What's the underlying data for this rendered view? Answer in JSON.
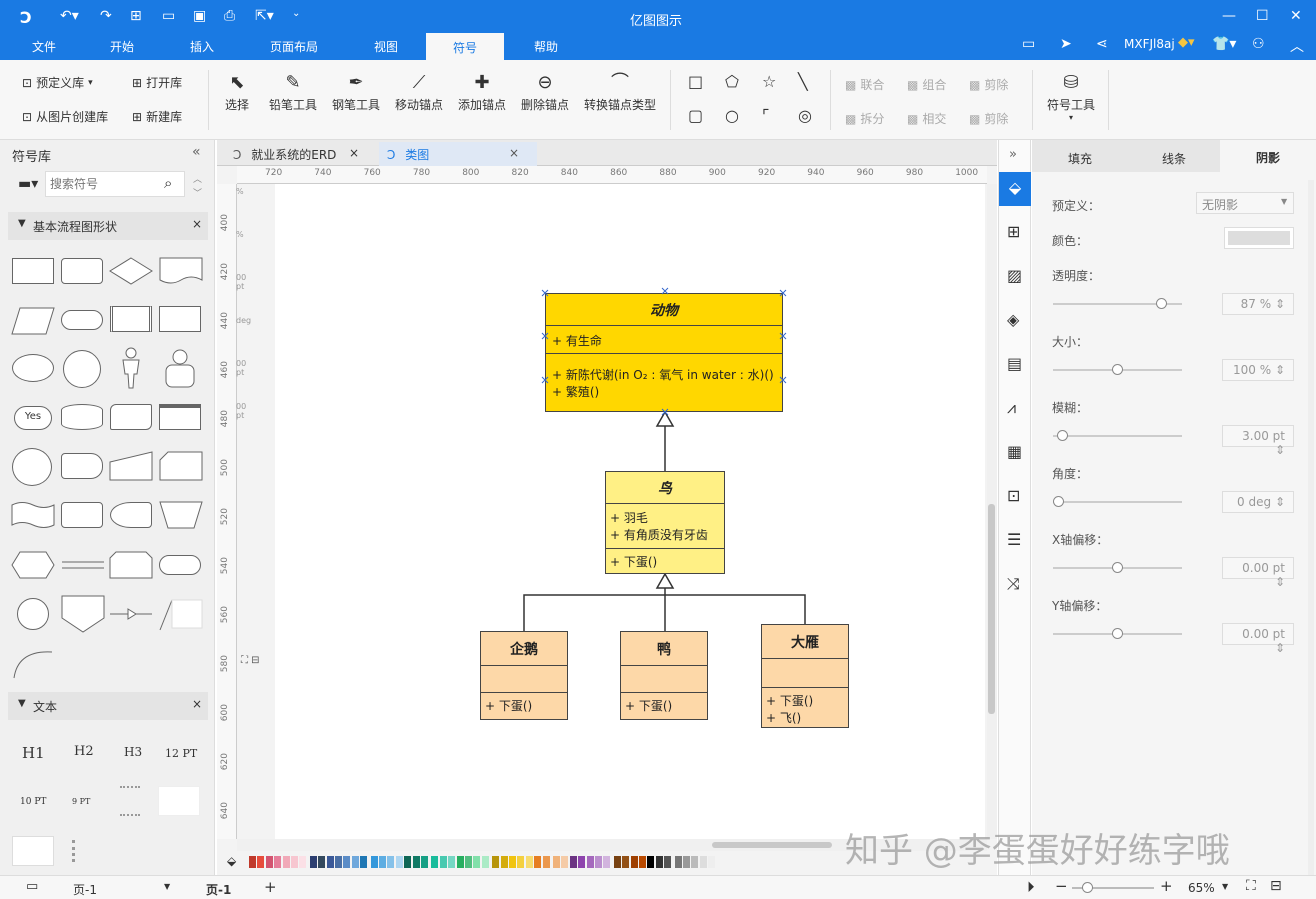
{
  "app": {
    "title": "亿图图示"
  },
  "menu": [
    "文件",
    "开始",
    "插入",
    "页面布局",
    "视图",
    "符号",
    "帮助"
  ],
  "user": {
    "name": "MXFJl8aj"
  },
  "ribbon": {
    "lib_predefined": "预定义库",
    "lib_open": "打开库",
    "lib_from_image": "从图片创建库",
    "lib_new": "新建库",
    "tools": [
      "选择",
      "铅笔工具",
      "钢笔工具",
      "移动锚点",
      "添加锚点",
      "删除锚点",
      "转换锚点类型"
    ],
    "ops_row1": [
      "联合",
      "组合",
      "剪除"
    ],
    "ops_row2": [
      "拆分",
      "相交",
      "剪除"
    ],
    "symbol_tool": "符号工具"
  },
  "left": {
    "title": "符号库",
    "search_placeholder": "搜索符号",
    "section1": "基本流程图形状",
    "section2": "文本",
    "text_items": [
      "H1",
      "H2",
      "H3",
      "12 PT",
      "10 PT",
      "9 PT"
    ],
    "yes_label": "Yes"
  },
  "tabs": [
    {
      "label": "就业系统的ERD"
    },
    {
      "label": "类图"
    }
  ],
  "ruler_top": [
    "720",
    "740",
    "760",
    "780",
    "800",
    "820",
    "840",
    "860",
    "880",
    "900",
    "920",
    "940",
    "960",
    "980",
    "1000"
  ],
  "ruler_left": [
    "400",
    "420",
    "440",
    "460",
    "480",
    "500",
    "520",
    "540",
    "560",
    "580",
    "600",
    "620",
    "640"
  ],
  "ruler_fields": [
    "%",
    "%",
    "00 pt",
    "deg",
    "00 pt",
    "00 pt"
  ],
  "diagram": {
    "animal": {
      "name": "动物",
      "attr": "+   有生命",
      "m1": "+   新陈代谢(in O₂ : 氧气  in water : 水)()",
      "m2": "+   繁殖()"
    },
    "bird": {
      "name": "鸟",
      "a1": "+   羽毛",
      "a2": "+   有角质没有牙齿",
      "m1": "+   下蛋()"
    },
    "penguin": {
      "name": "企鹅",
      "m1": "+   下蛋()"
    },
    "duck": {
      "name": "鸭",
      "m1": "+   下蛋()"
    },
    "goose": {
      "name": "大雁",
      "m1": "+   下蛋()",
      "m2": "+   飞()"
    }
  },
  "right": {
    "tabs": [
      "填充",
      "线条",
      "阴影"
    ],
    "predefined_label": "预定义：",
    "predefined_value": "无阴影",
    "color_label": "颜色：",
    "transparency_label": "透明度：",
    "transparency_value": "87 %",
    "size_label": "大小：",
    "size_value": "100 %",
    "blur_label": "模糊：",
    "blur_value": "3.00 pt",
    "angle_label": "角度：",
    "angle_value": "0 deg",
    "xoffset_label": "X轴偏移：",
    "xoffset_value": "0.00 pt",
    "yoffset_label": "Y轴偏移：",
    "yoffset_value": "0.00 pt"
  },
  "status": {
    "page_select": "页-1",
    "page_tab": "页-1",
    "zoom": "65%"
  },
  "watermark": "知乎 @李蛋蛋好好练字哦",
  "colors": {
    "accent": "#1a7ae3",
    "animal_fill": "#ffd700",
    "bird_fill": "#fff085",
    "sub_fill": "#fdd8a8"
  }
}
